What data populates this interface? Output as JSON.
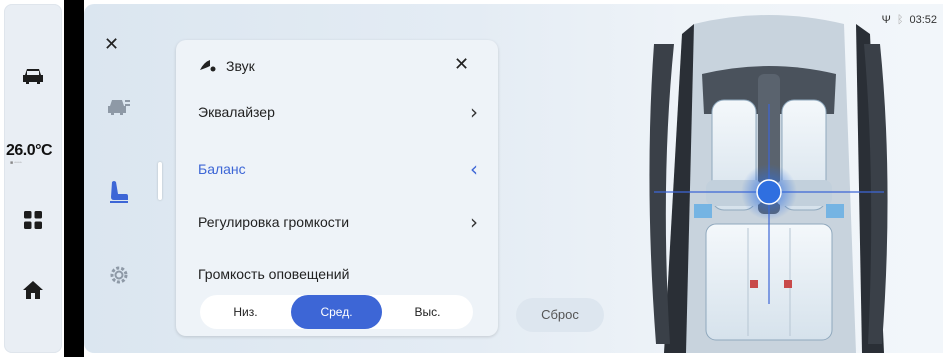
{
  "status_bar": {
    "time": "03:52",
    "icons": [
      "usb-icon",
      "bluetooth-icon"
    ]
  },
  "dock": {
    "items": [
      {
        "icon": "car-icon"
      },
      {
        "icon": "grid-icon"
      },
      {
        "icon": "home-icon"
      }
    ],
    "temperature": "26.0°C",
    "temperature_sub": "■ ▫▫▫▫"
  },
  "categories": [
    {
      "icon": "vehicle-settings-icon"
    },
    {
      "icon": "seat-icon",
      "active": true
    },
    {
      "icon": "gear-icon"
    }
  ],
  "sound_panel": {
    "title": "Звук",
    "icon": "sound-icon",
    "menu": [
      {
        "label": "Эквалайзер",
        "chevron": "›",
        "active": false
      },
      {
        "label": "Баланс",
        "chevron": "‹",
        "active": true
      },
      {
        "label": "Регулировка громкости",
        "chevron": "›",
        "active": false
      }
    ],
    "alert_volume": {
      "label": "Громкость оповещений",
      "options": [
        "Низ.",
        "Сред.",
        "Выс."
      ],
      "selected": "Сред."
    }
  },
  "reset_button": "Сброс",
  "colors": {
    "accent": "#3d66d6",
    "panel_bg": "#eef3f8",
    "dock_bg": "#e9eef4"
  }
}
